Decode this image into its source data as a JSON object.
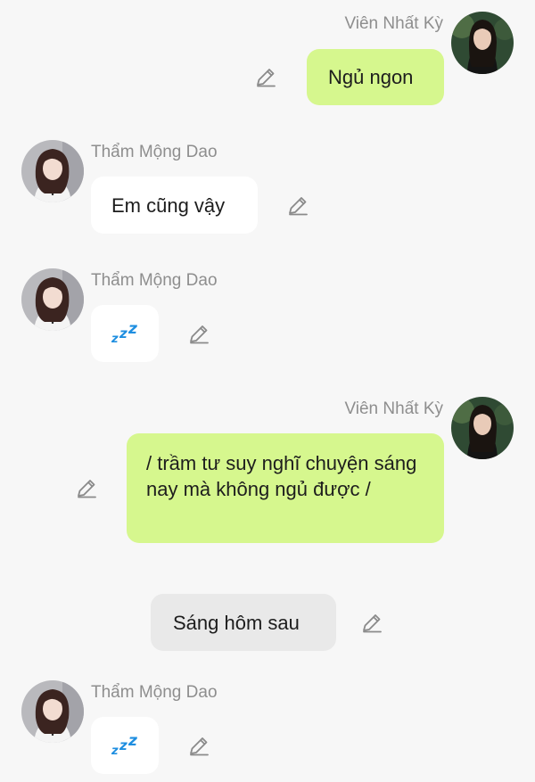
{
  "messages": [
    {
      "sender": "Viên Nhất Kỳ",
      "text": "Ngủ ngon"
    },
    {
      "sender": "Thẩm Mộng Dao",
      "text": "Em cũng vậy"
    },
    {
      "sender": "Thẩm Mộng Dao",
      "emoji": "zzz-emoji"
    },
    {
      "sender": "Viên Nhất Kỳ",
      "text": "/ trầm tư suy nghĩ chuyện sáng nay mà không ngủ được /"
    },
    {
      "system": "Sáng hôm sau"
    },
    {
      "sender": "Thẩm Mộng Dao",
      "emoji": "zzz-emoji"
    }
  ],
  "icons": {
    "edit": "pencil-icon"
  },
  "colors": {
    "background": "#f7f7f7",
    "self_bubble": "#d6f78e",
    "other_bubble": "#ffffff",
    "system_bubble": "#e9e9e9",
    "sender_name": "#8e8e8e",
    "zzz": "#1e8ee0"
  }
}
